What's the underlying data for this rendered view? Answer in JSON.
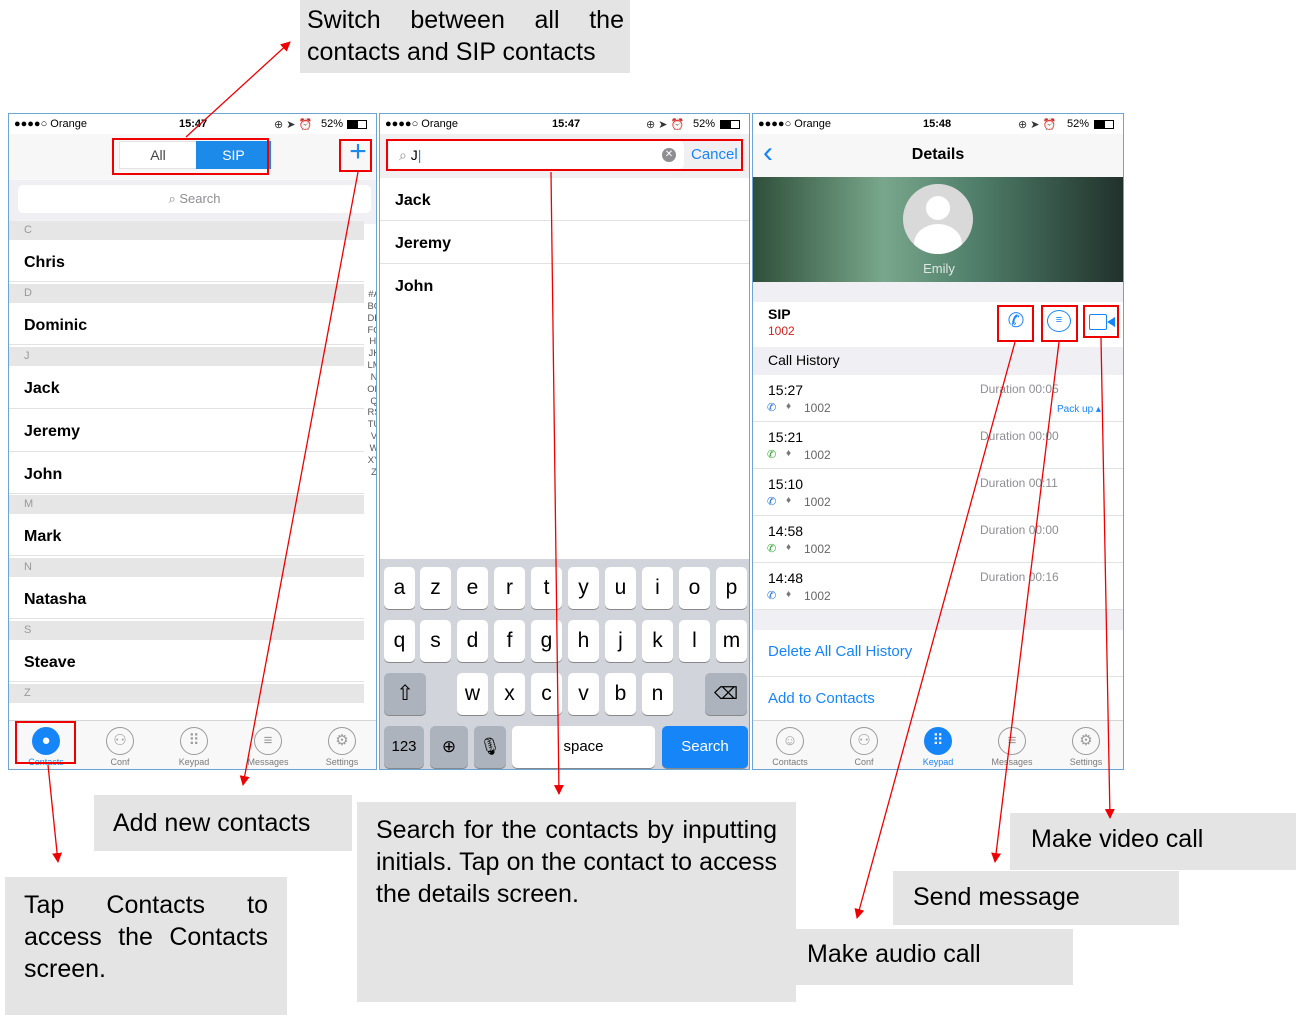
{
  "callouts": {
    "switch": "Switch between all the contacts and SIP contacts",
    "add": "Add new contacts",
    "tap_contacts": "Tap Contacts to access the Contacts screen.",
    "search": "Search for the contacts by inputting initials. Tap on the contact to access the details screen.",
    "video": "Make video call",
    "message": "Send message",
    "audio": "Make audio call"
  },
  "status": {
    "carrier": "●●●●○ Orange",
    "battery": "52%"
  },
  "screen1": {
    "time": "15:47",
    "seg_all": "All",
    "seg_sip": "SIP",
    "search_placeholder": "Search",
    "sections": [
      "C",
      "D",
      "J",
      "M",
      "N",
      "S",
      "Z"
    ],
    "contacts": [
      "Chris",
      "Dominic",
      "Jack",
      "Jeremy",
      "John",
      "Mark",
      "Natasha",
      "Steave"
    ],
    "index": "#ABCDEFGHIJKLMNOPQRSTUVWXYZ"
  },
  "screen2": {
    "time": "15:47",
    "query": "J",
    "cancel": "Cancel",
    "results": [
      "Jack",
      "Jeremy",
      "John"
    ],
    "keys_row1": [
      "a",
      "z",
      "e",
      "r",
      "t",
      "y",
      "u",
      "i",
      "o",
      "p"
    ],
    "keys_row2": [
      "q",
      "s",
      "d",
      "f",
      "g",
      "h",
      "j",
      "k",
      "l",
      "m"
    ],
    "keys_row3": [
      "w",
      "x",
      "c",
      "v",
      "b",
      "n"
    ],
    "key_123": "123",
    "key_space": "space",
    "key_search": "Search"
  },
  "screen3": {
    "time": "15:48",
    "title": "Details",
    "name": "Emily",
    "sip_label": "SIP",
    "sip_number": "1002",
    "call_history": "Call History",
    "pack_up": "Pack up",
    "calls": [
      {
        "time": "15:27",
        "duration": "Duration 00:05",
        "number": "1002",
        "color": "#1a6fd6"
      },
      {
        "time": "15:21",
        "duration": "Duration 00:00",
        "number": "1002",
        "color": "#2ca52c"
      },
      {
        "time": "15:10",
        "duration": "Duration 00:11",
        "number": "1002",
        "color": "#1a6fd6"
      },
      {
        "time": "14:58",
        "duration": "Duration 00:00",
        "number": "1002",
        "color": "#2ca52c"
      },
      {
        "time": "14:48",
        "duration": "Duration 00:16",
        "number": "1002",
        "color": "#1a6fd6"
      }
    ],
    "delete_all": "Delete All Call History",
    "add_contacts": "Add to Contacts"
  },
  "tabs": [
    "Contacts",
    "Conf",
    "Keypad",
    "Messages",
    "Settings"
  ]
}
